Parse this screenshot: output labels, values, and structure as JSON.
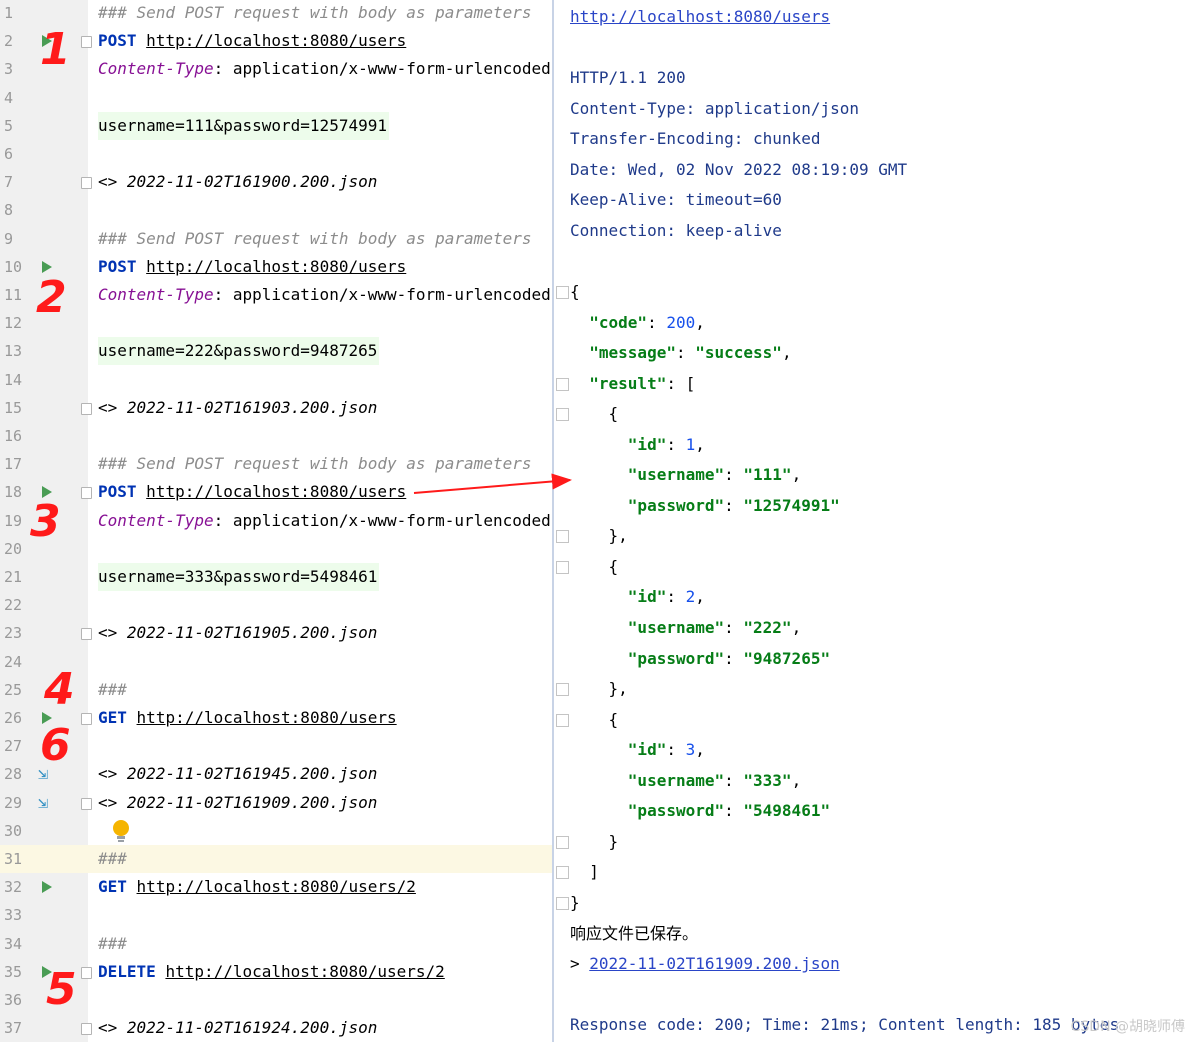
{
  "editor": {
    "lines": [
      {
        "n": "1",
        "parts": [
          {
            "t": "### Send POST request with body as parameters",
            "c": "cmt"
          }
        ]
      },
      {
        "n": "2",
        "run": true,
        "fold": true,
        "parts": [
          {
            "t": "POST",
            "c": "kw"
          },
          {
            "t": " ",
            "c": ""
          },
          {
            "t": "http://localhost:8080/users",
            "c": "url"
          }
        ]
      },
      {
        "n": "3",
        "parts": [
          {
            "t": "Content-Type",
            "c": "hdr"
          },
          {
            "t": ": application/x-www-form-urlencoded",
            "c": ""
          }
        ]
      },
      {
        "n": "4",
        "parts": []
      },
      {
        "n": "5",
        "parts": [
          {
            "t": "username=111&password=12574991",
            "c": "body"
          }
        ]
      },
      {
        "n": "6",
        "parts": []
      },
      {
        "n": "7",
        "fold": true,
        "parts": [
          {
            "t": "<> ",
            "c": ""
          },
          {
            "t": "2022-11-02T161900.200.json",
            "c": "ref"
          }
        ]
      },
      {
        "n": "8",
        "parts": []
      },
      {
        "n": "9",
        "parts": [
          {
            "t": "### Send POST request with body as parameters",
            "c": "cmt"
          }
        ]
      },
      {
        "n": "10",
        "run": true,
        "parts": [
          {
            "t": "POST",
            "c": "kw"
          },
          {
            "t": " ",
            "c": ""
          },
          {
            "t": "http://localhost:8080/users",
            "c": "url"
          }
        ]
      },
      {
        "n": "11",
        "parts": [
          {
            "t": "Content-Type",
            "c": "hdr"
          },
          {
            "t": ": application/x-www-form-urlencoded",
            "c": ""
          }
        ]
      },
      {
        "n": "12",
        "parts": []
      },
      {
        "n": "13",
        "parts": [
          {
            "t": "username=222&password=9487265",
            "c": "body"
          }
        ]
      },
      {
        "n": "14",
        "parts": []
      },
      {
        "n": "15",
        "fold": true,
        "parts": [
          {
            "t": "<> ",
            "c": ""
          },
          {
            "t": "2022-11-02T161903.200.json",
            "c": "ref"
          }
        ]
      },
      {
        "n": "16",
        "parts": []
      },
      {
        "n": "17",
        "parts": [
          {
            "t": "### Send POST request with body as parameters",
            "c": "cmt"
          }
        ]
      },
      {
        "n": "18",
        "run": true,
        "fold": true,
        "parts": [
          {
            "t": "POST",
            "c": "kw"
          },
          {
            "t": " ",
            "c": ""
          },
          {
            "t": "http://localhost:8080/users",
            "c": "url"
          }
        ]
      },
      {
        "n": "19",
        "parts": [
          {
            "t": "Content-Type",
            "c": "hdr"
          },
          {
            "t": ": application/x-www-form-urlencoded",
            "c": ""
          }
        ]
      },
      {
        "n": "20",
        "parts": []
      },
      {
        "n": "21",
        "parts": [
          {
            "t": "username=333&password=5498461",
            "c": "body"
          }
        ]
      },
      {
        "n": "22",
        "parts": []
      },
      {
        "n": "23",
        "fold": true,
        "parts": [
          {
            "t": "<> ",
            "c": ""
          },
          {
            "t": "2022-11-02T161905.200.json",
            "c": "ref"
          }
        ]
      },
      {
        "n": "24",
        "parts": []
      },
      {
        "n": "25",
        "parts": [
          {
            "t": "###",
            "c": "cmt"
          }
        ]
      },
      {
        "n": "26",
        "run": true,
        "fold": true,
        "parts": [
          {
            "t": "GET",
            "c": "kw"
          },
          {
            "t": " ",
            "c": ""
          },
          {
            "t": "http://localhost:8080/users",
            "c": "url"
          }
        ]
      },
      {
        "n": "27",
        "parts": []
      },
      {
        "n": "28",
        "compare": true,
        "parts": [
          {
            "t": "<> ",
            "c": ""
          },
          {
            "t": "2022-11-02T161945.200.json",
            "c": "ref"
          }
        ]
      },
      {
        "n": "29",
        "compare": true,
        "fold": true,
        "parts": [
          {
            "t": "<> ",
            "c": ""
          },
          {
            "t": "2022-11-02T161909.200.json",
            "c": "ref"
          }
        ]
      },
      {
        "n": "30",
        "bulb": true,
        "parts": []
      },
      {
        "n": "31",
        "hl": true,
        "parts": [
          {
            "t": "###",
            "c": "cmt"
          }
        ]
      },
      {
        "n": "32",
        "run": true,
        "parts": [
          {
            "t": "GET",
            "c": "kw"
          },
          {
            "t": " ",
            "c": ""
          },
          {
            "t": "http://localhost:8080/users/2",
            "c": "url"
          }
        ]
      },
      {
        "n": "33",
        "parts": []
      },
      {
        "n": "34",
        "parts": [
          {
            "t": "###",
            "c": "cmt"
          }
        ]
      },
      {
        "n": "35",
        "run": true,
        "fold": true,
        "parts": [
          {
            "t": "DELETE",
            "c": "kw"
          },
          {
            "t": " ",
            "c": ""
          },
          {
            "t": "http://localhost:8080/users/2",
            "c": "url"
          }
        ]
      },
      {
        "n": "36",
        "parts": []
      },
      {
        "n": "37",
        "fold": true,
        "parts": [
          {
            "t": "<> ",
            "c": ""
          },
          {
            "t": "2022-11-02T161924.200.json",
            "c": "ref"
          }
        ]
      }
    ]
  },
  "annotations": [
    "1",
    "2",
    "3",
    "4",
    "6",
    "5"
  ],
  "response": {
    "lines": [
      {
        "parts": [
          {
            "t": "http://localhost:8080/users",
            "c": "rlink"
          }
        ]
      },
      {
        "parts": []
      },
      {
        "parts": [
          {
            "t": "HTTP/1.1 200",
            "c": "hk"
          }
        ]
      },
      {
        "parts": [
          {
            "t": "Content-Type: application/json",
            "c": "hk"
          }
        ]
      },
      {
        "parts": [
          {
            "t": "Transfer-Encoding: chunked",
            "c": "hk"
          }
        ]
      },
      {
        "parts": [
          {
            "t": "Date: Wed, 02 Nov 2022 08:19:09 GMT",
            "c": "hk"
          }
        ]
      },
      {
        "parts": [
          {
            "t": "Keep-Alive: timeout=60",
            "c": "hk"
          }
        ]
      },
      {
        "parts": [
          {
            "t": "Connection: keep-alive",
            "c": "hk"
          }
        ]
      },
      {
        "parts": []
      },
      {
        "fold": true,
        "parts": [
          {
            "t": "{",
            "c": ""
          }
        ]
      },
      {
        "parts": [
          {
            "t": "  ",
            "c": ""
          },
          {
            "t": "\"code\"",
            "c": "jk"
          },
          {
            "t": ": ",
            "c": ""
          },
          {
            "t": "200",
            "c": "jn"
          },
          {
            "t": ",",
            "c": ""
          }
        ]
      },
      {
        "parts": [
          {
            "t": "  ",
            "c": ""
          },
          {
            "t": "\"message\"",
            "c": "jk"
          },
          {
            "t": ": ",
            "c": ""
          },
          {
            "t": "\"success\"",
            "c": "js"
          },
          {
            "t": ",",
            "c": ""
          }
        ]
      },
      {
        "fold": true,
        "parts": [
          {
            "t": "  ",
            "c": ""
          },
          {
            "t": "\"result\"",
            "c": "jk"
          },
          {
            "t": ": [",
            "c": ""
          }
        ]
      },
      {
        "fold": true,
        "parts": [
          {
            "t": "    {",
            "c": ""
          }
        ]
      },
      {
        "parts": [
          {
            "t": "      ",
            "c": ""
          },
          {
            "t": "\"id\"",
            "c": "jk"
          },
          {
            "t": ": ",
            "c": ""
          },
          {
            "t": "1",
            "c": "jn"
          },
          {
            "t": ",",
            "c": ""
          }
        ]
      },
      {
        "parts": [
          {
            "t": "      ",
            "c": ""
          },
          {
            "t": "\"username\"",
            "c": "jk"
          },
          {
            "t": ": ",
            "c": ""
          },
          {
            "t": "\"111\"",
            "c": "js"
          },
          {
            "t": ",",
            "c": ""
          }
        ]
      },
      {
        "parts": [
          {
            "t": "      ",
            "c": ""
          },
          {
            "t": "\"password\"",
            "c": "jk"
          },
          {
            "t": ": ",
            "c": ""
          },
          {
            "t": "\"12574991\"",
            "c": "js"
          }
        ]
      },
      {
        "fold": true,
        "parts": [
          {
            "t": "    },",
            "c": ""
          }
        ]
      },
      {
        "fold": true,
        "parts": [
          {
            "t": "    {",
            "c": ""
          }
        ]
      },
      {
        "parts": [
          {
            "t": "      ",
            "c": ""
          },
          {
            "t": "\"id\"",
            "c": "jk"
          },
          {
            "t": ": ",
            "c": ""
          },
          {
            "t": "2",
            "c": "jn"
          },
          {
            "t": ",",
            "c": ""
          }
        ]
      },
      {
        "parts": [
          {
            "t": "      ",
            "c": ""
          },
          {
            "t": "\"username\"",
            "c": "jk"
          },
          {
            "t": ": ",
            "c": ""
          },
          {
            "t": "\"222\"",
            "c": "js"
          },
          {
            "t": ",",
            "c": ""
          }
        ]
      },
      {
        "parts": [
          {
            "t": "      ",
            "c": ""
          },
          {
            "t": "\"password\"",
            "c": "jk"
          },
          {
            "t": ": ",
            "c": ""
          },
          {
            "t": "\"9487265\"",
            "c": "js"
          }
        ]
      },
      {
        "fold": true,
        "parts": [
          {
            "t": "    },",
            "c": ""
          }
        ]
      },
      {
        "fold": true,
        "parts": [
          {
            "t": "    {",
            "c": ""
          }
        ]
      },
      {
        "parts": [
          {
            "t": "      ",
            "c": ""
          },
          {
            "t": "\"id\"",
            "c": "jk"
          },
          {
            "t": ": ",
            "c": ""
          },
          {
            "t": "3",
            "c": "jn"
          },
          {
            "t": ",",
            "c": ""
          }
        ]
      },
      {
        "parts": [
          {
            "t": "      ",
            "c": ""
          },
          {
            "t": "\"username\"",
            "c": "jk"
          },
          {
            "t": ": ",
            "c": ""
          },
          {
            "t": "\"333\"",
            "c": "js"
          },
          {
            "t": ",",
            "c": ""
          }
        ]
      },
      {
        "parts": [
          {
            "t": "      ",
            "c": ""
          },
          {
            "t": "\"password\"",
            "c": "jk"
          },
          {
            "t": ": ",
            "c": ""
          },
          {
            "t": "\"5498461\"",
            "c": "js"
          }
        ]
      },
      {
        "fold": true,
        "parts": [
          {
            "t": "    }",
            "c": ""
          }
        ]
      },
      {
        "fold": true,
        "parts": [
          {
            "t": "  ]",
            "c": ""
          }
        ]
      },
      {
        "fold": true,
        "parts": [
          {
            "t": "}",
            "c": ""
          }
        ]
      },
      {
        "parts": [
          {
            "t": "响应文件已保存。",
            "c": "saved"
          }
        ]
      },
      {
        "parts": [
          {
            "t": "> ",
            "c": ""
          },
          {
            "t": "2022-11-02T161909.200.json",
            "c": "rlink"
          }
        ]
      },
      {
        "parts": []
      },
      {
        "parts": [
          {
            "t": "Response code: 200; Time: 21ms; Content length: 185 bytes",
            "c": "hk"
          }
        ]
      }
    ]
  },
  "watermark": "CSDN @胡晓师傅",
  "colors": {
    "annotation": "#ff1a1a",
    "run": "#499c54",
    "keyword": "#0033b3",
    "json_key": "#067d17"
  }
}
